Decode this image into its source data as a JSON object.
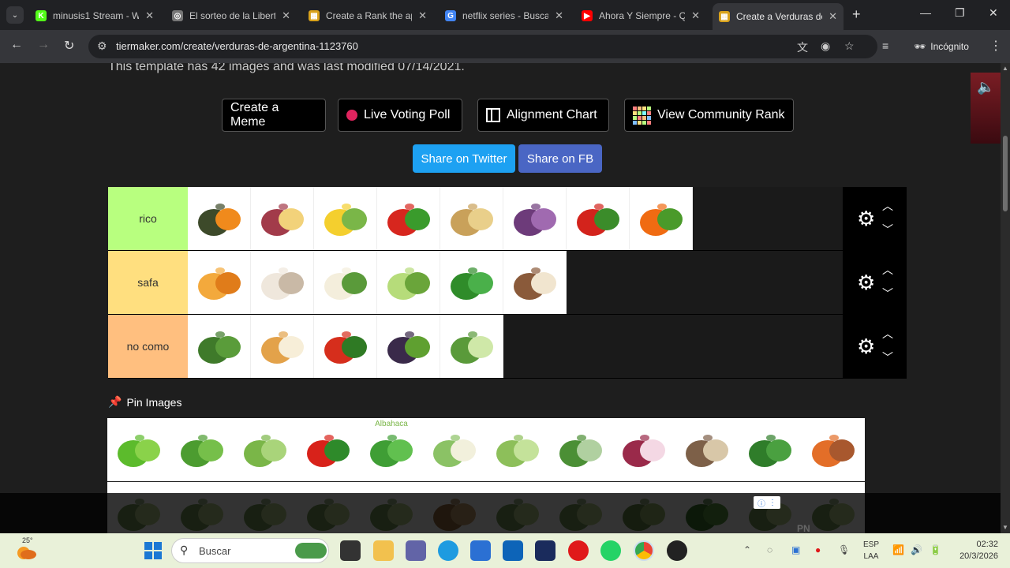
{
  "browser": {
    "tabs": [
      {
        "title": "minusis1 Stream - W",
        "favicon": "kick-icon",
        "color": "#53fc18",
        "glyph": "K"
      },
      {
        "title": "El sorteo de la Liberta",
        "favicon": "globe-icon",
        "color": "#777777",
        "glyph": "◎"
      },
      {
        "title": "Create a Rank the ap",
        "favicon": "tiermaker-icon",
        "color": "#d9a21b",
        "glyph": "▦"
      },
      {
        "title": "netflix series - Buscar",
        "favicon": "google-icon",
        "color": "#4285f4",
        "glyph": "G"
      },
      {
        "title": "Ahora Y Siempre - Q",
        "favicon": "youtube-icon",
        "color": "#ff0000",
        "glyph": "▶"
      },
      {
        "title": "Create a Verduras de",
        "favicon": "tiermaker-icon",
        "color": "#d9a21b",
        "glyph": "▦"
      }
    ],
    "active_tab": 5,
    "url": "tiermaker.com/create/verduras-de-argentina-1123760",
    "incognito_label": "Incógnito"
  },
  "page": {
    "template_info": "This template has 42 images and was last modified 07/14/2021.",
    "actions": {
      "create_meme": "Create a Meme",
      "live_voting": "Live Voting Poll",
      "alignment_chart": "Alignment Chart",
      "community_rank": "View Community Rank"
    },
    "share": {
      "twitter": "Share on Twitter",
      "twitter_color": "#1da1f2",
      "fb": "Share on FB",
      "fb_color": "#4a66c4"
    },
    "tiers": [
      {
        "label": "rico",
        "color": "#b8ff7f",
        "items": [
          "pumpkin",
          "sweet-potato",
          "corn",
          "bell-peppers",
          "potatoes",
          "red-cabbage",
          "tomatoes",
          "carrots"
        ]
      },
      {
        "label": "safa",
        "color": "#ffdf7f",
        "items": [
          "butternut-squash",
          "garlic",
          "cauliflower",
          "lettuce",
          "arugula",
          "cassava"
        ]
      },
      {
        "label": "no como",
        "color": "#ffbf7f",
        "items": [
          "kale",
          "onion",
          "cherry-tomatoes",
          "eggplant",
          "cucumber"
        ]
      }
    ],
    "pin_images_label": "Pin Images",
    "pool": [
      "peas",
      "green-beans",
      "celery",
      "chili-peppers",
      "basil",
      "leek",
      "brussels-sprouts",
      "spring-onion",
      "red-onion",
      "jerusalem-artichoke",
      "spinach",
      "yam"
    ],
    "pool_row2": [
      "pool-item",
      "pool-item",
      "pool-item",
      "pool-item",
      "pool-item",
      "potato-2",
      "pool-item",
      "pool-item",
      "artichoke",
      "broccoli",
      "pool-item",
      "pool-item"
    ],
    "basil_caption": "Albahaca",
    "ad_footer": "PN"
  },
  "taskbar": {
    "weather_temp": "25°",
    "search_placeholder": "Buscar",
    "language": "ESP\nLAA",
    "lang_line1": "ESP",
    "lang_line2": "LAA",
    "time": "02:32",
    "date": "20/3/2026"
  }
}
